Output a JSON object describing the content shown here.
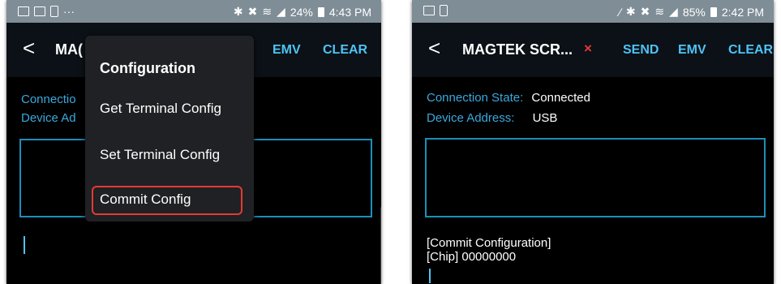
{
  "left_screen": {
    "status_bar": {
      "left_icons": [
        "image-icon",
        "image-icon",
        "person-icon",
        "more-icon"
      ],
      "more_text": "···",
      "right_icons": [
        "bluetooth-icon",
        "mute-icon",
        "wifi-icon",
        "signal-icon"
      ],
      "battery": "24%",
      "time": "4:43 PM"
    },
    "toolbar": {
      "back": "<",
      "title": "MA(",
      "emv": "EMV",
      "clear": "CLEAR"
    },
    "info": {
      "connection_label": "Connectio",
      "device_label": "Device Ad"
    },
    "menu": {
      "title": "Configuration",
      "items": [
        "Get Terminal Config",
        "Set Terminal Config",
        "Commit Config"
      ],
      "highlighted_item": "Commit Config",
      "highlight_color": "#e53935"
    }
  },
  "right_screen": {
    "status_bar": {
      "left_icons": [
        "image-icon",
        "app-icon"
      ],
      "right_icons": [
        "pen-icon",
        "bluetooth-icon",
        "mute-icon",
        "wifi-icon",
        "signal-icon"
      ],
      "battery": "85%",
      "time": "2:42 PM"
    },
    "toolbar": {
      "back": "<",
      "title": "MAGTEK SCR...",
      "close": "×",
      "send": "SEND",
      "emv": "EMV",
      "clear": "CLEAR"
    },
    "info": {
      "connection_label": "Connection State:",
      "connection_value": "Connected",
      "device_label": "Device Address:",
      "device_value": "USB"
    },
    "log": [
      "[Commit Configuration]",
      "[Chip] 00000000"
    ]
  },
  "colors": {
    "status_bar": "#7f8d96",
    "toolbar": "#0b1116",
    "accent": "#4fc3f7",
    "label_blue": "#3aa9de",
    "box_border": "#1b8fb8",
    "close_red": "#e53935"
  }
}
